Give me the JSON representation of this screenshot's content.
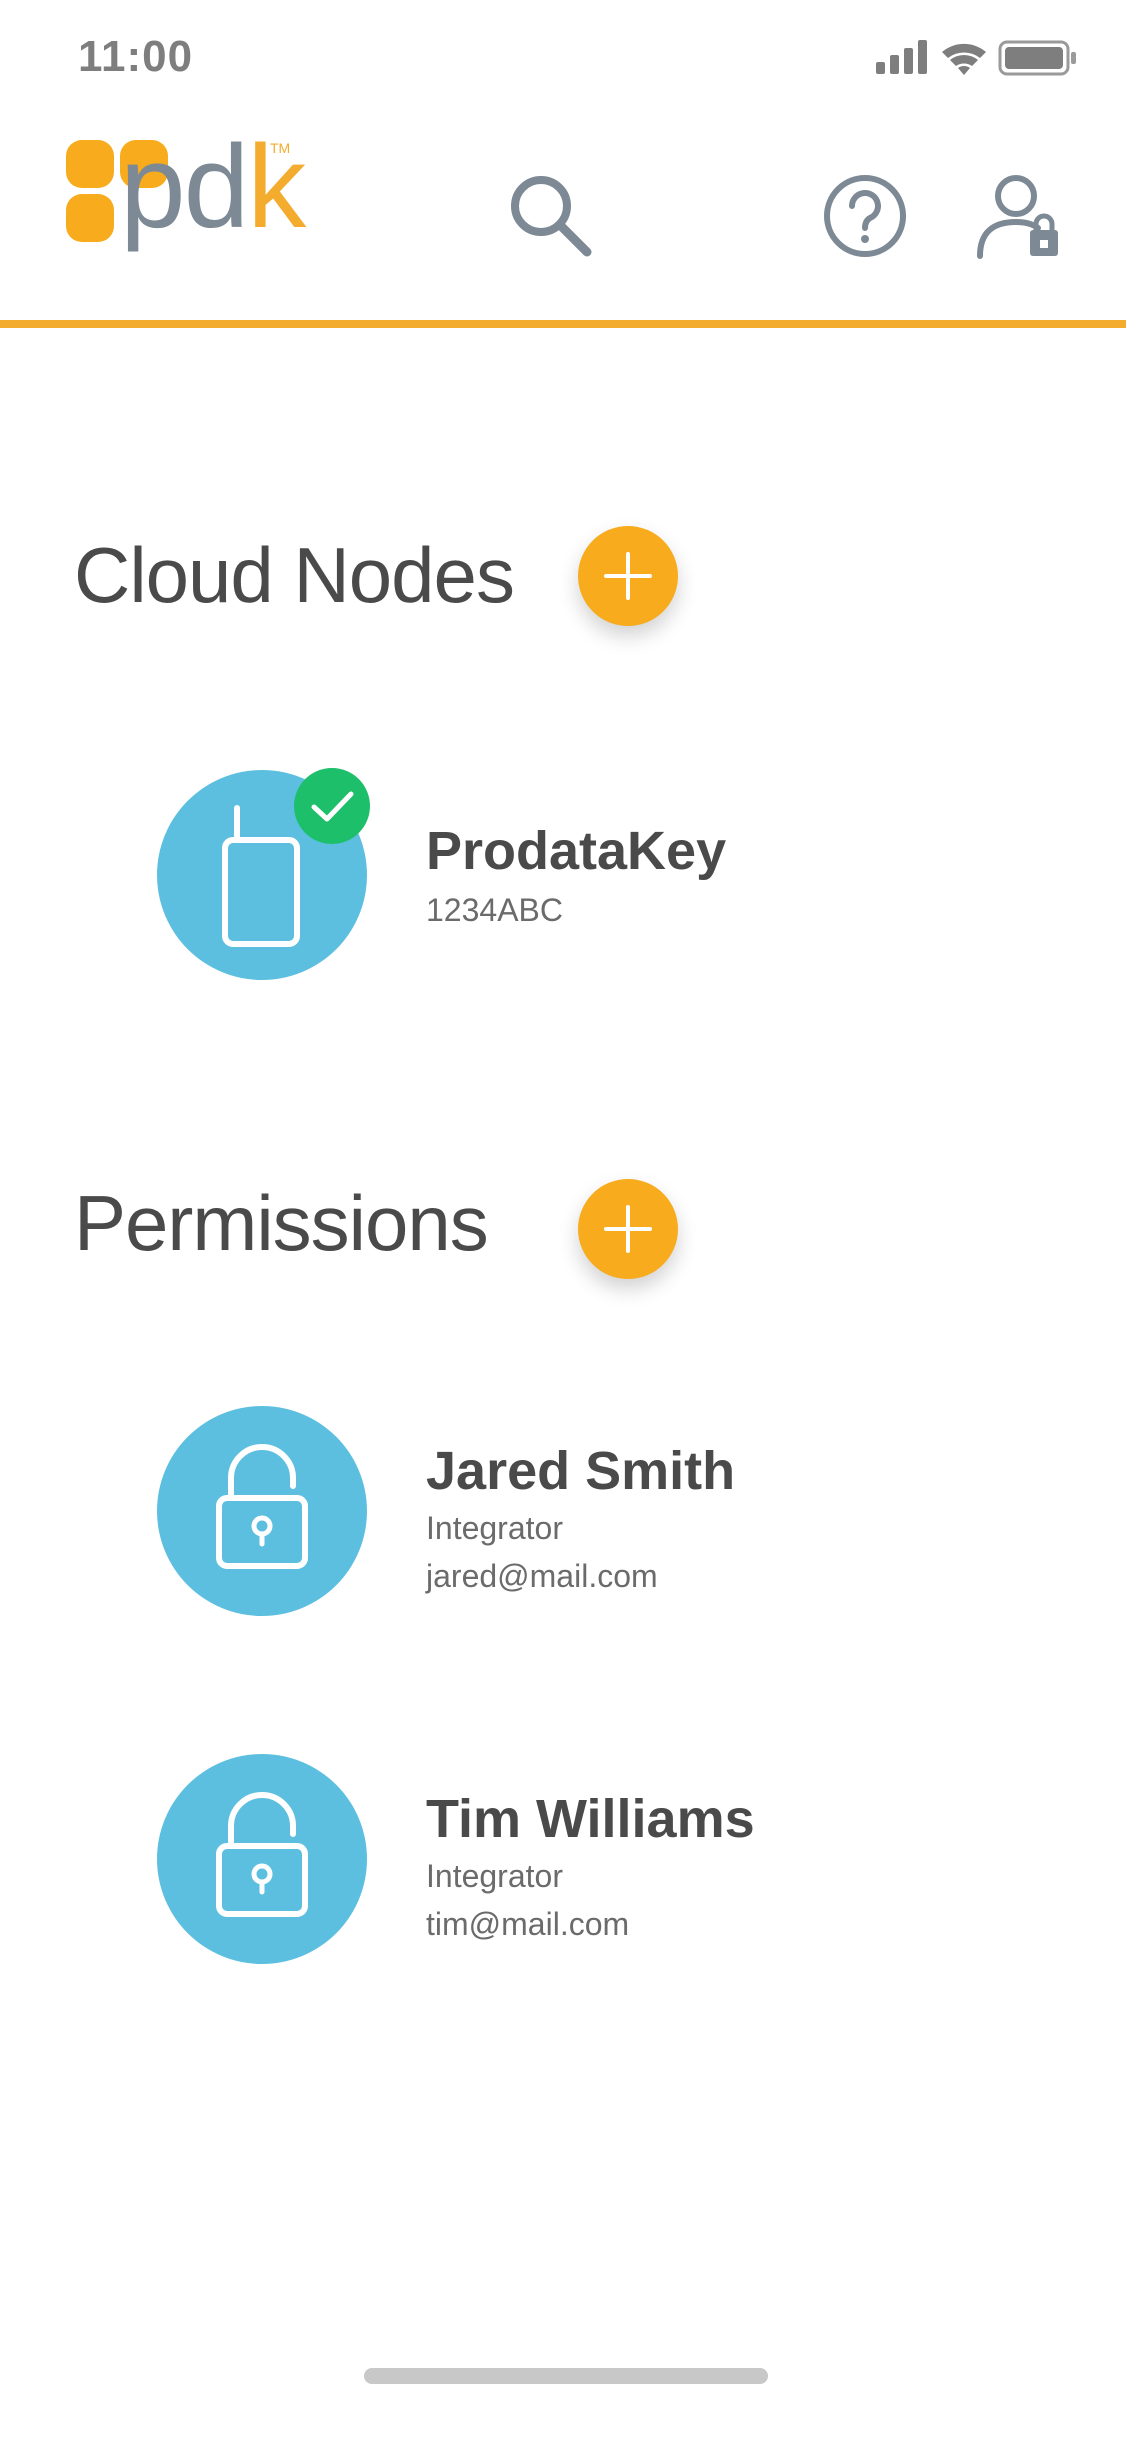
{
  "status_bar": {
    "time": "11:00",
    "icons": [
      "cellular-signal-icon",
      "wifi-icon",
      "battery-icon"
    ]
  },
  "header": {
    "logo": {
      "text_pd": "pd",
      "text_k": "k",
      "trademark": "TM"
    },
    "icons": [
      "search-icon",
      "help-icon",
      "user-lock-icon"
    ],
    "accent_color": "#f3ac2e"
  },
  "cloud_nodes": {
    "title": "Cloud Nodes",
    "items": [
      {
        "name": "ProdataKey",
        "id": "1234ABC",
        "icon": "device-icon",
        "status": "check-icon"
      }
    ]
  },
  "permissions": {
    "title": "Permissions",
    "items": [
      {
        "name": "Jared Smith",
        "role": "Integrator",
        "email": "jared@mail.com",
        "icon": "unlock-icon"
      },
      {
        "name": "Tim Williams",
        "role": "Integrator",
        "email": "tim@mail.com",
        "icon": "unlock-icon"
      }
    ]
  },
  "colors": {
    "accent": "#f7ab1d",
    "avatar": "#5dbfe0",
    "success": "#1dbf6a",
    "text": "#4a4a4a"
  }
}
